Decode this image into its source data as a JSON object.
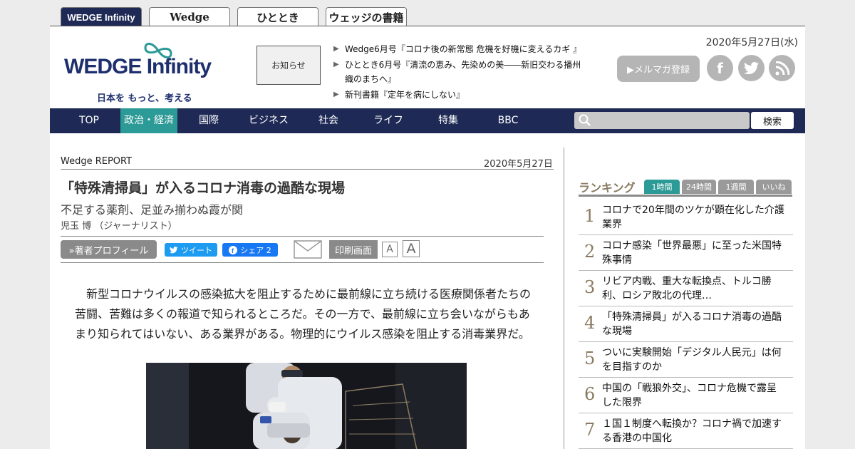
{
  "site_tabs": [
    "WEDGE Infinity",
    "Wedge",
    "ひととき",
    "ウェッジの書籍"
  ],
  "header": {
    "logo_main": "WEDGE",
    "logo_sub": "Infinity",
    "logo_tagline": "日本を もっと、考える",
    "notice_label": "お知らせ",
    "news": [
      "Wedge6月号『コロナ後の新常態 危機を好機に変えるカギ 』",
      "ひととき6月号『清流の恵み、先染めの美――新旧交わる播州織のまちへ』",
      "新刊書籍『定年を病にしない』"
    ],
    "date": "2020年5月27日(水)",
    "mail_magazine": "▶メルマガ登録",
    "social": [
      "f",
      "t",
      "rss"
    ]
  },
  "nav": {
    "items": [
      "TOP",
      "政治・経済",
      "国際",
      "ビジネス",
      "社会",
      "ライフ",
      "特集",
      "BBC"
    ],
    "active": "政治・経済",
    "search_button": "検索"
  },
  "article": {
    "category": "Wedge REPORT",
    "date": "2020年5月27日",
    "title": "「特殊清掃員」が入るコロナ消毒の過酷な現場",
    "subtitle": "不足する薬剤、足並み揃わぬ霞が関",
    "author": "児玉 博 （ジャーナリスト）",
    "profile_button": "»著者プロフィール",
    "tweet_button": "ツイート",
    "share_button": "シェア 2",
    "print_button": "印刷画面",
    "font_small": "A",
    "font_large": "A",
    "body": "新型コロナウイルスの感染拡大を阻止するために最前線に立ち続ける医療関係者たちの苦闘、苦難は多くの報道で知られるところだ。その一方で、最前線に立ち会いながらもあまり知られてはいない、ある業界がある。物理的にウイルス感染を阻止する消毒業界だ。"
  },
  "ranking": {
    "title": "ランキング",
    "tabs": [
      "1時間",
      "24時間",
      "1週間",
      "いいね"
    ],
    "active_tab": "1時間",
    "items": [
      {
        "num": "1",
        "text": "コロナで20年間のツケが顕在化した介護業界"
      },
      {
        "num": "2",
        "text": "コロナ感染「世界最悪」に至った米国特殊事情"
      },
      {
        "num": "3",
        "text": "リビア内戦、重大な転換点、トルコ勝利、ロシア敗北の代理…"
      },
      {
        "num": "4",
        "text": "「特殊清掃員」が入るコロナ消毒の過酷な現場"
      },
      {
        "num": "5",
        "text": "ついに実験開始「デジタル人民元」は何を目指すのか"
      },
      {
        "num": "6",
        "text": "中国の「戦狼外交」、コロナ危機で露呈した限界"
      },
      {
        "num": "7",
        "text": "１国１制度へ転換か？コロナ禍で加速する香港の中国化"
      }
    ]
  },
  "colors": {
    "navy": "#1e2a55",
    "teal": "#2c9a96",
    "rank_gold": "#8a7a60"
  }
}
